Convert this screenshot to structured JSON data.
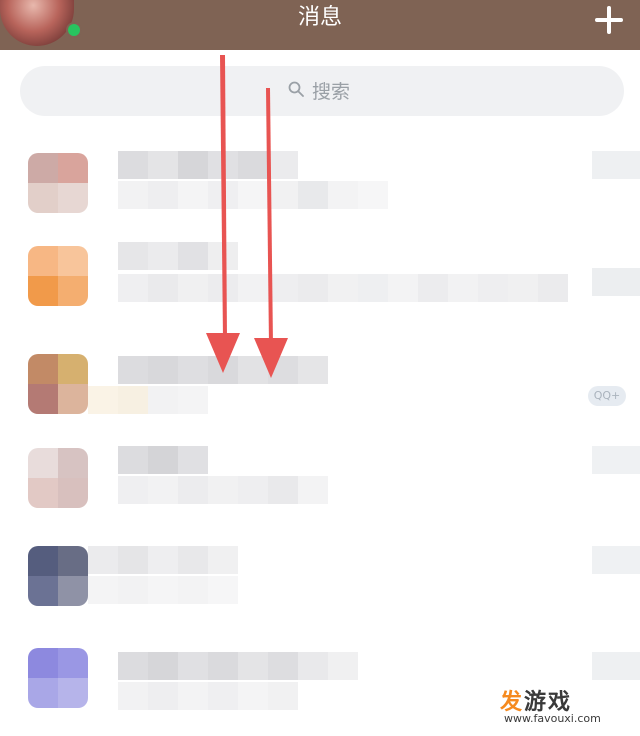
{
  "header": {
    "title": "消息"
  },
  "search": {
    "placeholder": "搜索"
  },
  "watermark": {
    "brand_first": "发",
    "brand_rest": "游戏",
    "url": "www.favouxi.com"
  },
  "colors": {
    "header_bg": "#7f6354",
    "arrow": "#e85452",
    "online": "#28c45f"
  },
  "icons": [
    "avatar",
    "online-status-icon",
    "add-icon",
    "search-icon",
    "arrow-down-icon"
  ]
}
